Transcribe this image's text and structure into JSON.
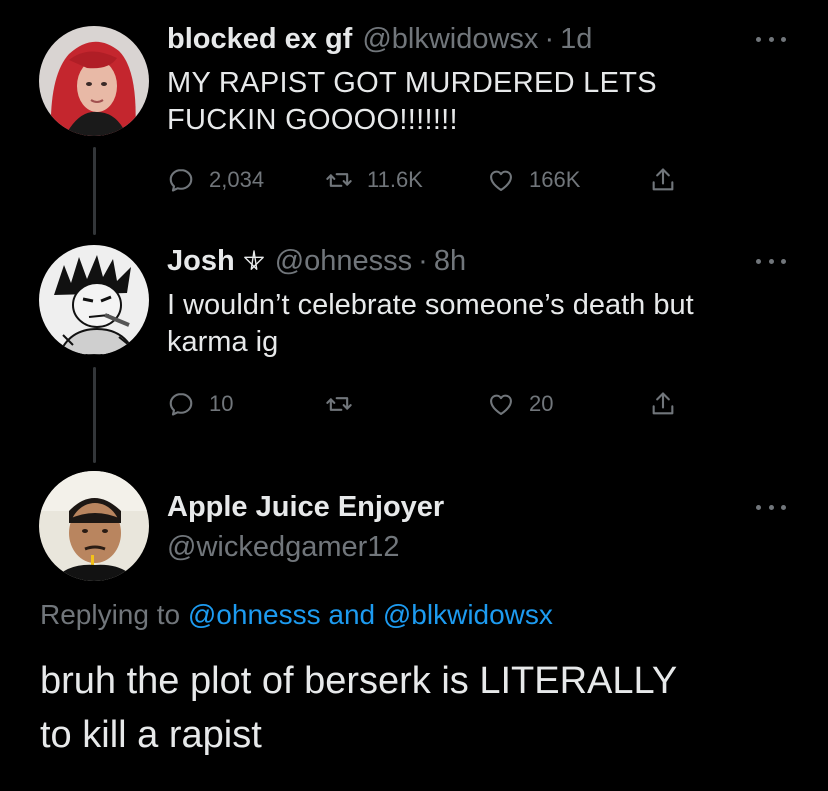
{
  "tweets": [
    {
      "display_name": "blocked ex gf",
      "handle": "@blkwidowsx",
      "dot": "·",
      "time": "1d",
      "text_lines": [
        "MY RAPIST GOT MURDERED LETS",
        "FUCKIN GOOOO!!!!!!!"
      ],
      "reply_count": "2,034",
      "retweet_count": "11.6K",
      "like_count": "166K"
    },
    {
      "display_name": "Josh",
      "handle": "@ohnesss",
      "dot": "·",
      "time": "8h",
      "text_lines": [
        "I wouldn’t celebrate someone’s death but",
        "karma ig"
      ],
      "reply_count": "10",
      "retweet_count": "",
      "like_count": "20"
    }
  ],
  "main_tweet": {
    "display_name": "Apple Juice Enjoyer",
    "handle": "@wickedgamer12",
    "replying_prefix": "Replying to",
    "mention_1": "@ohnesss",
    "conjunction": "and",
    "mention_2": "@blkwidowsx",
    "text_lines": [
      "bruh the plot of berserk is LITERALLY",
      "to kill a rapist"
    ]
  },
  "icons": [
    "reply-icon",
    "retweet-icon",
    "like-icon",
    "share-icon",
    "more-icon",
    "pentagram-icon"
  ],
  "colors": {
    "background": "#000000",
    "text": "#e7e9ea",
    "muted": "#71767b",
    "link": "#1d9bf0",
    "thread_line": "#333639"
  }
}
